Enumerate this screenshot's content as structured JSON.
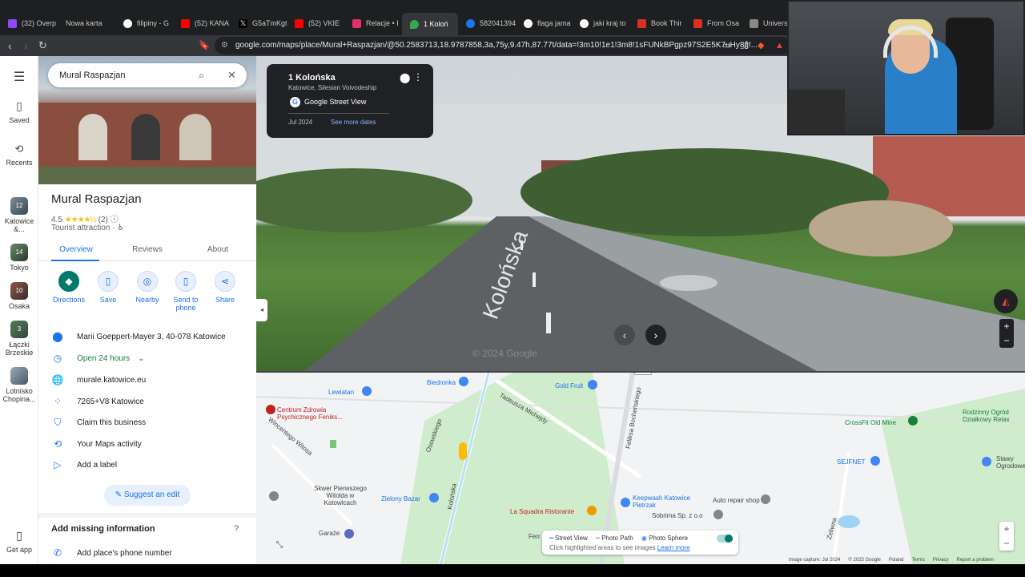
{
  "browser": {
    "tabs": [
      {
        "label": "(32) Overp",
        "color": "#9146ff"
      },
      {
        "label": "Nowa karta",
        "color": "#3c4043"
      },
      {
        "label": "filipiny - G",
        "color": "#ffffff"
      },
      {
        "label": "(52) KANA",
        "color": "#ff0000"
      },
      {
        "label": "G5aTmKgt",
        "color": "#000000"
      },
      {
        "label": "(52) VKIE",
        "color": "#ff0000"
      },
      {
        "label": "Relacje • I",
        "color": "#e1306c"
      },
      {
        "label": "1 Koloń",
        "color": "#34a853"
      },
      {
        "label": "582041394",
        "color": "#1877f2"
      },
      {
        "label": "flaga jama",
        "color": "#ffffff"
      },
      {
        "label": "jaki kraj to",
        "color": "#ffffff"
      },
      {
        "label": "Book Thir",
        "color": "#d93025"
      },
      {
        "label": "From Osa",
        "color": "#d93025"
      },
      {
        "label": "Universa",
        "color": "#888888"
      }
    ],
    "url": "google.com/maps/place/Mural+Raspazjan/@50.2583713,18.9787858,3a,75y,9.47h,87.77t/data=!3m10!1e1!3m8!1sFUNkBPgpz97S2E5K7uHy8g!..."
  },
  "rail": {
    "menu": "☰",
    "saved": "Saved",
    "recents": "Recents",
    "recent_places": [
      {
        "label": "Katowice &...",
        "badge": "12"
      },
      {
        "label": "Tokyo",
        "badge": "14"
      },
      {
        "label": "Osaka",
        "badge": "10"
      },
      {
        "label": "Łączki Brzeskie",
        "badge": "3"
      },
      {
        "label": "Lotnisko Chopina...",
        "badge": ""
      }
    ],
    "get_app": "Get app"
  },
  "search": {
    "value": "Mural Raspazjan"
  },
  "place": {
    "name": "Mural Raspazjan",
    "rating": "4.5",
    "stars": "★★★★½",
    "review_count": "(2)",
    "category": "Tourist attraction · ♿",
    "tabs": [
      "Overview",
      "Reviews",
      "About"
    ],
    "actions": [
      "Directions",
      "Save",
      "Nearby",
      "Send to phone",
      "Share"
    ],
    "address": "Marii Goeppert-Mayer 3, 40-078 Katowice",
    "hours": "Open 24 hours",
    "website": "murale.katowice.eu",
    "plus_code": "7265+V8 Katowice",
    "claim": "Claim this business",
    "activity": "Your Maps activity",
    "label": "Add a label",
    "suggest": "Suggest an edit",
    "missing_title": "Add missing information",
    "phone": "Add place's phone number"
  },
  "streetview": {
    "title": "1 Kolońska",
    "subtitle": "Katowice, Silesian Voivodeship",
    "source": "Google Street View",
    "date": "Jul 2024",
    "more_dates": "See more dates",
    "road_paint": "Kolońska",
    "watermark": "© 2024 Google"
  },
  "map": {
    "labels": [
      "Lewiatan",
      "Biedronka",
      "Gold Fruit",
      "Centrum Zdrowia Psychicznego Feniks...",
      "Wincentego Witosa",
      "Osowskiego",
      "Kolońska",
      "Tadeusza Michejdy",
      "Feliksa Bocheńskiego",
      "CrossFit Old Mine",
      "Rodzinny Ogród Działkowy Relax",
      "SEJFNET",
      "Skwer Pierwszego Witolda w Katowicach",
      "Zielony Bazar",
      "La Squadra Ristorante",
      "Auto repair shop",
      "Keepwash Katowice Pietrzak",
      "Sobrima Sp. z o.o",
      "Zeliwna",
      "Garaże",
      "Ferr",
      "Stawy Ogrodowe"
    ],
    "legend_street_view": "Street View",
    "legend_photo_path": "Photo Path",
    "legend_photo_sphere": "Photo Sphere",
    "legend_hint": "Click highlighted areas to see images",
    "legend_learn": "Learn more",
    "footer": [
      "Image capture: Jul 2024",
      "© 2025 Google",
      "Poland",
      "Terms",
      "Privacy",
      "Report a problem"
    ]
  },
  "colors": {
    "accent": "#1a73e8",
    "teal": "#00796b",
    "open": "#188038"
  }
}
